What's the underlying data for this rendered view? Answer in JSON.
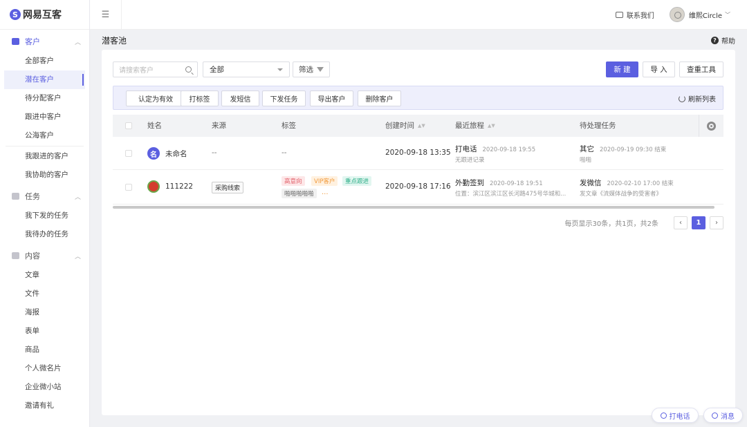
{
  "brand": {
    "name": "网易互客",
    "accent": "#5b5fe0"
  },
  "header": {
    "contact": "联系我们",
    "user": "维熙Circle"
  },
  "sidebar": {
    "customer_group": "客户",
    "customer_items": [
      "全部客户",
      "潜在客户",
      "待分配客户",
      "跟进中客户",
      "公海客户"
    ],
    "mine_items": [
      "我跟进的客户",
      "我协助的客户"
    ],
    "task_group": "任务",
    "task_items": [
      "我下发的任务",
      "我待办的任务"
    ],
    "content_group": "内容",
    "content_items": [
      "文章",
      "文件",
      "海报",
      "表单",
      "商品",
      "个人微名片",
      "企业微小站",
      "邀请有礼"
    ]
  },
  "page": {
    "title": "潜客池",
    "help": "帮助"
  },
  "toolbar": {
    "search_placeholder": "请搜索客户",
    "select_value": "全部",
    "filter_label": "筛选",
    "new_label": "新 建",
    "import_label": "导 入",
    "dedupe_label": "查重工具"
  },
  "actions": {
    "buttons": [
      "认定为有效",
      "打标签",
      "发短信",
      "下发任务",
      "导出客户",
      "删除客户"
    ],
    "refresh": "刷新列表"
  },
  "table": {
    "headers": [
      "姓名",
      "来源",
      "标签",
      "创建时间",
      "最近旅程",
      "待处理任务"
    ],
    "rows": [
      {
        "avatar_text": "名",
        "name": "未命名",
        "source": "--",
        "tags": [
          "--"
        ],
        "created": "2020-09-18 13:35",
        "journey_title": "打电话",
        "journey_time": "2020-09-18 19:55",
        "journey_sub": "无跟进记录",
        "task_title": "其它",
        "task_time": "2020-09-19 09:30 结束",
        "task_sub": "啪啪"
      },
      {
        "avatar_text": "",
        "name": "111222",
        "source": "采购线索",
        "tags": [
          "高意向",
          "VIP客户",
          "重点跟进",
          "啪啪啪啪啪"
        ],
        "more": "...",
        "created": "2020-09-18 17:16",
        "journey_title": "外勤签到",
        "journey_time": "2020-09-18 19:51",
        "journey_sub": "位置：滨江区滨江区长河路475号华城和...",
        "task_title": "发微信",
        "task_time": "2020-02-10 17:00 结束",
        "task_sub": "发文章《流媒体战争的受害者》"
      }
    ]
  },
  "pagination": {
    "info": "每页显示30条，共1页，共2条",
    "prev": "‹",
    "current": "1",
    "next": "›"
  },
  "floating": {
    "call": "打电话",
    "message": "消息"
  }
}
